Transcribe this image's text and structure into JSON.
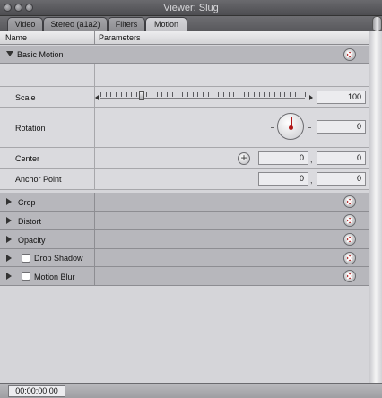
{
  "window": {
    "title": "Viewer: Slug"
  },
  "tabs": [
    {
      "label": "Video",
      "active": false
    },
    {
      "label": "Stereo (a1a2)",
      "active": false
    },
    {
      "label": "Filters",
      "active": false
    },
    {
      "label": "Motion",
      "active": true
    }
  ],
  "columns": {
    "name": "Name",
    "parameters": "Parameters"
  },
  "basic_motion": {
    "label": "Basic Motion",
    "expanded": true,
    "scale": {
      "label": "Scale",
      "value": "100",
      "slider_fraction": 0.2
    },
    "rotation": {
      "label": "Rotation",
      "value": "0"
    },
    "center": {
      "label": "Center",
      "x": "0",
      "y": "0",
      "separator": ","
    },
    "anchor_point": {
      "label": "Anchor Point",
      "x": "0",
      "y": "0",
      "separator": ","
    }
  },
  "groups": [
    {
      "label": "Crop",
      "has_checkbox": false,
      "checked": false
    },
    {
      "label": "Distort",
      "has_checkbox": false,
      "checked": false
    },
    {
      "label": "Opacity",
      "has_checkbox": false,
      "checked": false
    },
    {
      "label": "Drop Shadow",
      "has_checkbox": true,
      "checked": false
    },
    {
      "label": "Motion Blur",
      "has_checkbox": true,
      "checked": false
    }
  ],
  "timecode": "00:00:00:00",
  "icons": {
    "expanded": "disclosure-triangle-down-icon",
    "collapsed": "disclosure-triangle-right-icon",
    "reset": "reset-x-icon",
    "point": "crosshair-plus-icon",
    "dial": "rotation-dial-icon"
  },
  "colors": {
    "reset_accent": "#b01818",
    "group_row": "#b7b7bc",
    "param_row": "#dadade"
  }
}
